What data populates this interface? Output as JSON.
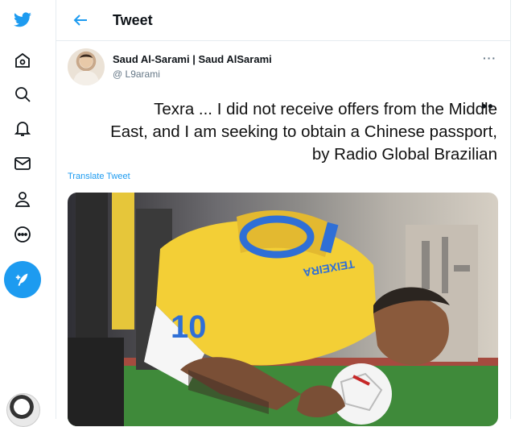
{
  "header": {
    "title": "Tweet"
  },
  "tweet": {
    "author_name": "Saud Al-Sarami | Saud AlSarami",
    "author_handle": "@ L9arami",
    "more_label": "···",
    "text_line1": "Texra ... I did not receive offers from the Middle",
    "text_line2": "East, and I am seeking to obtain a Chinese passport,",
    "text_line3": "by Radio Global Brazilian",
    "trailing_dots": "••",
    "translate_label": "Translate Tweet"
  },
  "media": {
    "jersey_name": "TEIXEIRA",
    "jersey_number": "10"
  },
  "colors": {
    "accent": "#1d9bf0",
    "jersey": "#f3cf36",
    "jersey_blue": "#2f6fd6"
  },
  "icons": [
    "twitter-logo-icon",
    "home-icon",
    "search-icon",
    "notifications-icon",
    "messages-icon",
    "profile-icon",
    "more-icon",
    "compose-icon",
    "back-arrow-icon"
  ]
}
